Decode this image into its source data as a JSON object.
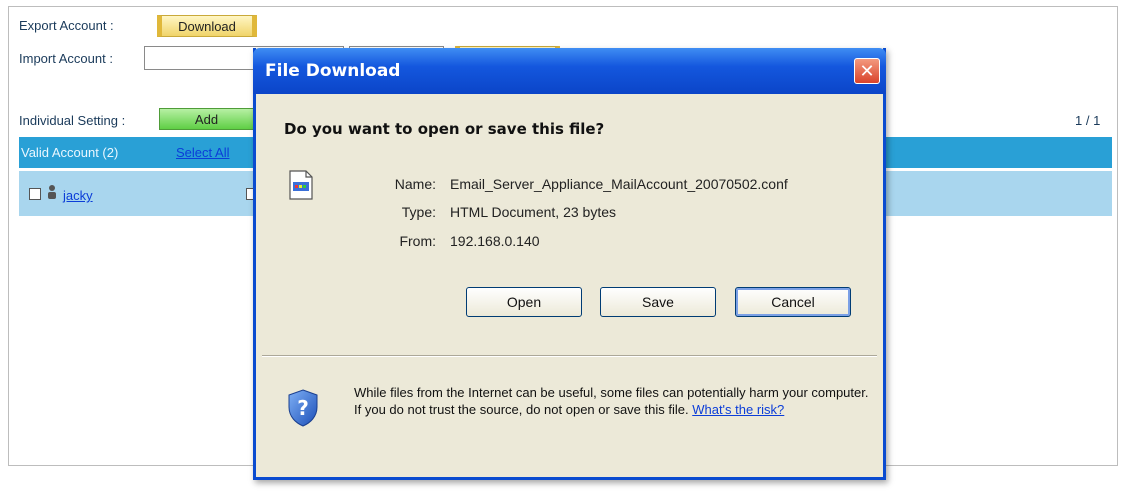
{
  "page": {
    "export_label": "Export Account :",
    "download_label": "Download",
    "import_label": "Import Account :",
    "individual_label": "Individual Setting :",
    "add_label": "Add",
    "pagination": "1 / 1",
    "valid_account": "Valid Account (2)",
    "select_all": "Select All",
    "account_name": "jacky"
  },
  "dialog": {
    "title": "File Download",
    "question": "Do you want to open or save this file?",
    "name_label": "Name:",
    "name_value": "Email_Server_Appliance_MailAccount_20070502.conf",
    "type_label": "Type:",
    "type_value": "HTML Document, 23 bytes",
    "from_label": "From:",
    "from_value": "192.168.0.140",
    "open_label": "Open",
    "save_label": "Save",
    "cancel_label": "Cancel",
    "warning": "While files from the Internet can be useful, some files can potentially harm your computer. If you do not trust the source, do not open or save this file.",
    "risk_link": "What's the risk?"
  },
  "colors": {
    "title_bar": "#0b45c8",
    "dialog_bg": "#ece9d8",
    "header_bar": "#29a0d6",
    "row_bar": "#a9d6ee",
    "add_button": "#5fcf45",
    "download_button": "#f0d46a"
  },
  "icons": [
    "user-icon",
    "document-icon",
    "shield-question-icon",
    "close-icon"
  ]
}
